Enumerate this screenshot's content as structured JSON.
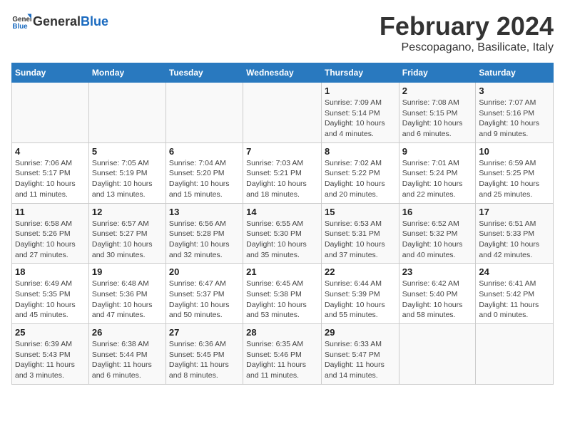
{
  "logo": {
    "text_general": "General",
    "text_blue": "Blue"
  },
  "header": {
    "title": "February 2024",
    "subtitle": "Pescopagano, Basilicate, Italy"
  },
  "columns": [
    "Sunday",
    "Monday",
    "Tuesday",
    "Wednesday",
    "Thursday",
    "Friday",
    "Saturday"
  ],
  "weeks": [
    [
      {
        "day": "",
        "info": ""
      },
      {
        "day": "",
        "info": ""
      },
      {
        "day": "",
        "info": ""
      },
      {
        "day": "",
        "info": ""
      },
      {
        "day": "1",
        "info": "Sunrise: 7:09 AM\nSunset: 5:14 PM\nDaylight: 10 hours\nand 4 minutes."
      },
      {
        "day": "2",
        "info": "Sunrise: 7:08 AM\nSunset: 5:15 PM\nDaylight: 10 hours\nand 6 minutes."
      },
      {
        "day": "3",
        "info": "Sunrise: 7:07 AM\nSunset: 5:16 PM\nDaylight: 10 hours\nand 9 minutes."
      }
    ],
    [
      {
        "day": "4",
        "info": "Sunrise: 7:06 AM\nSunset: 5:17 PM\nDaylight: 10 hours\nand 11 minutes."
      },
      {
        "day": "5",
        "info": "Sunrise: 7:05 AM\nSunset: 5:19 PM\nDaylight: 10 hours\nand 13 minutes."
      },
      {
        "day": "6",
        "info": "Sunrise: 7:04 AM\nSunset: 5:20 PM\nDaylight: 10 hours\nand 15 minutes."
      },
      {
        "day": "7",
        "info": "Sunrise: 7:03 AM\nSunset: 5:21 PM\nDaylight: 10 hours\nand 18 minutes."
      },
      {
        "day": "8",
        "info": "Sunrise: 7:02 AM\nSunset: 5:22 PM\nDaylight: 10 hours\nand 20 minutes."
      },
      {
        "day": "9",
        "info": "Sunrise: 7:01 AM\nSunset: 5:24 PM\nDaylight: 10 hours\nand 22 minutes."
      },
      {
        "day": "10",
        "info": "Sunrise: 6:59 AM\nSunset: 5:25 PM\nDaylight: 10 hours\nand 25 minutes."
      }
    ],
    [
      {
        "day": "11",
        "info": "Sunrise: 6:58 AM\nSunset: 5:26 PM\nDaylight: 10 hours\nand 27 minutes."
      },
      {
        "day": "12",
        "info": "Sunrise: 6:57 AM\nSunset: 5:27 PM\nDaylight: 10 hours\nand 30 minutes."
      },
      {
        "day": "13",
        "info": "Sunrise: 6:56 AM\nSunset: 5:28 PM\nDaylight: 10 hours\nand 32 minutes."
      },
      {
        "day": "14",
        "info": "Sunrise: 6:55 AM\nSunset: 5:30 PM\nDaylight: 10 hours\nand 35 minutes."
      },
      {
        "day": "15",
        "info": "Sunrise: 6:53 AM\nSunset: 5:31 PM\nDaylight: 10 hours\nand 37 minutes."
      },
      {
        "day": "16",
        "info": "Sunrise: 6:52 AM\nSunset: 5:32 PM\nDaylight: 10 hours\nand 40 minutes."
      },
      {
        "day": "17",
        "info": "Sunrise: 6:51 AM\nSunset: 5:33 PM\nDaylight: 10 hours\nand 42 minutes."
      }
    ],
    [
      {
        "day": "18",
        "info": "Sunrise: 6:49 AM\nSunset: 5:35 PM\nDaylight: 10 hours\nand 45 minutes."
      },
      {
        "day": "19",
        "info": "Sunrise: 6:48 AM\nSunset: 5:36 PM\nDaylight: 10 hours\nand 47 minutes."
      },
      {
        "day": "20",
        "info": "Sunrise: 6:47 AM\nSunset: 5:37 PM\nDaylight: 10 hours\nand 50 minutes."
      },
      {
        "day": "21",
        "info": "Sunrise: 6:45 AM\nSunset: 5:38 PM\nDaylight: 10 hours\nand 53 minutes."
      },
      {
        "day": "22",
        "info": "Sunrise: 6:44 AM\nSunset: 5:39 PM\nDaylight: 10 hours\nand 55 minutes."
      },
      {
        "day": "23",
        "info": "Sunrise: 6:42 AM\nSunset: 5:40 PM\nDaylight: 10 hours\nand 58 minutes."
      },
      {
        "day": "24",
        "info": "Sunrise: 6:41 AM\nSunset: 5:42 PM\nDaylight: 11 hours\nand 0 minutes."
      }
    ],
    [
      {
        "day": "25",
        "info": "Sunrise: 6:39 AM\nSunset: 5:43 PM\nDaylight: 11 hours\nand 3 minutes."
      },
      {
        "day": "26",
        "info": "Sunrise: 6:38 AM\nSunset: 5:44 PM\nDaylight: 11 hours\nand 6 minutes."
      },
      {
        "day": "27",
        "info": "Sunrise: 6:36 AM\nSunset: 5:45 PM\nDaylight: 11 hours\nand 8 minutes."
      },
      {
        "day": "28",
        "info": "Sunrise: 6:35 AM\nSunset: 5:46 PM\nDaylight: 11 hours\nand 11 minutes."
      },
      {
        "day": "29",
        "info": "Sunrise: 6:33 AM\nSunset: 5:47 PM\nDaylight: 11 hours\nand 14 minutes."
      },
      {
        "day": "",
        "info": ""
      },
      {
        "day": "",
        "info": ""
      }
    ]
  ]
}
